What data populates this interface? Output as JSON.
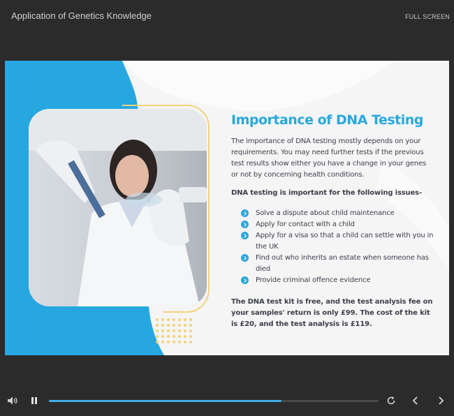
{
  "app": {
    "title": "Application of Genetics Knowledge",
    "fullscreen_label": "FULL SCREEN"
  },
  "slide": {
    "heading": "Importance of DNA Testing",
    "intro": "The importance of DNA testing mostly depends on your requirements. You may need further tests if the previous test results show either you have a change in your genes or not by concerning health conditions.",
    "subhead": "DNA testing is important for the following issues-",
    "bullets": [
      "Solve a dispute about child maintenance",
      "Apply for contact with a child",
      "Apply for a visa so that a child can settle with you in the UK",
      "Find out who inherits an estate when someone has died",
      "Provide  criminal offence evidence"
    ],
    "closing": "The DNA test kit is free, and the test analysis fee on your samples' return is only £99. The cost of the kit is £20, and the test analysis is £119."
  },
  "player": {
    "progress_fraction": 0.705,
    "icons": [
      "volume-icon",
      "pause-icon",
      "replay-icon",
      "prev-icon",
      "next-icon"
    ]
  },
  "colors": {
    "accent": "#2aa8dc",
    "gold": "#f2d27a",
    "background": "#2b2b2b"
  }
}
